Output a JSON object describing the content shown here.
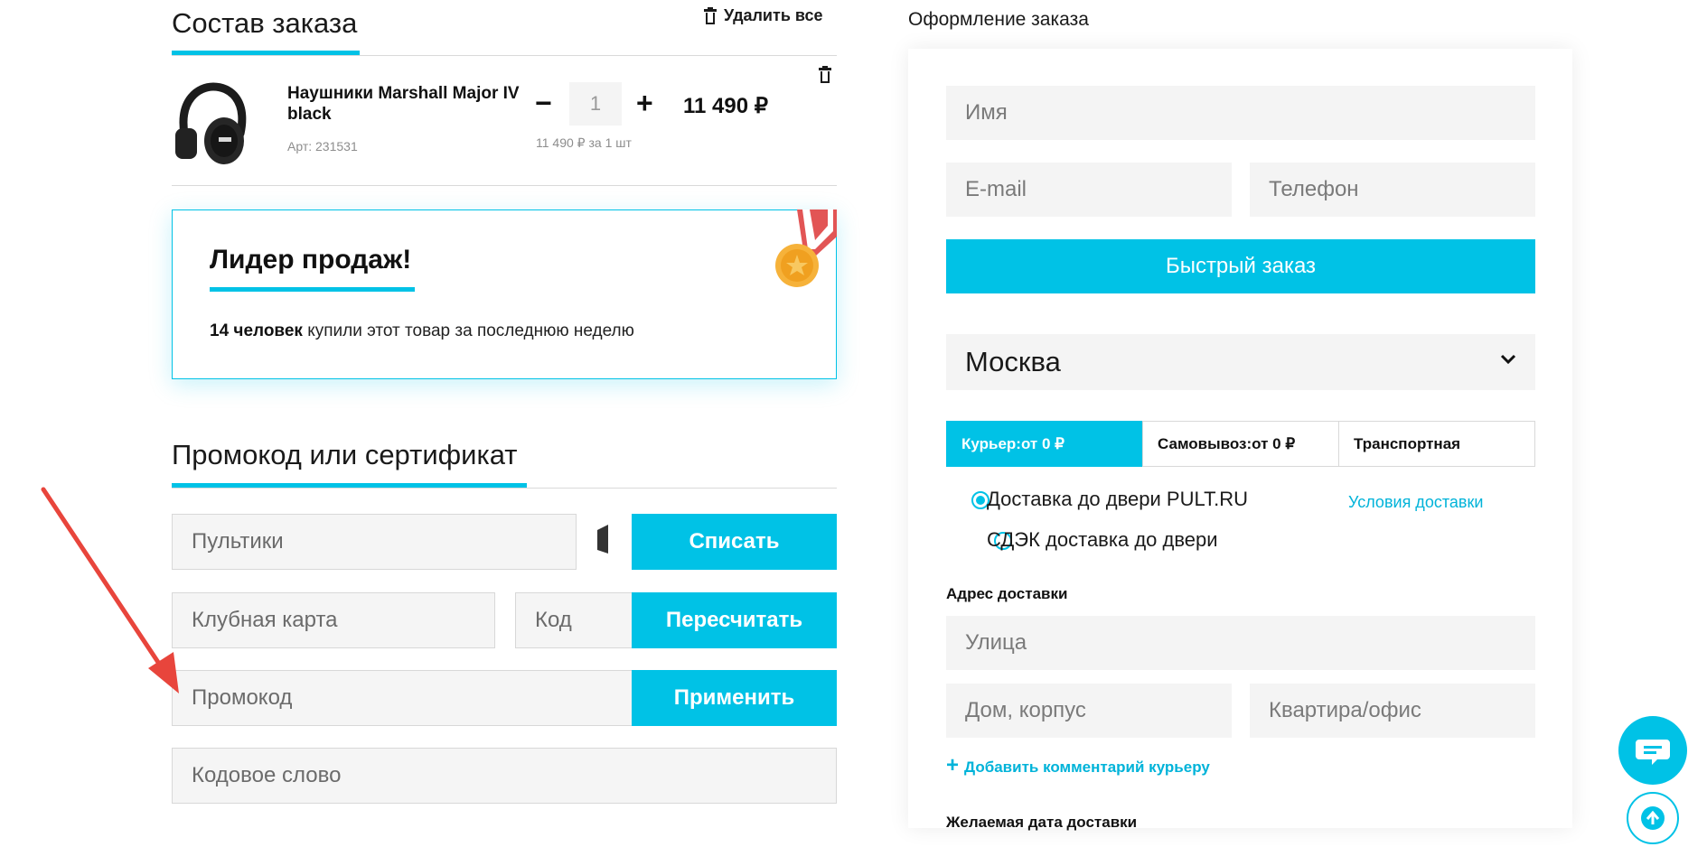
{
  "order": {
    "title": "Состав заказа",
    "delete_all_label": "Удалить все",
    "item": {
      "name_line1": "Наушники Marshall Major IV",
      "name_line2": "black",
      "article": "Арт: 231531",
      "quantity": "1",
      "price": "11 490 ₽",
      "unit_price": "11 490 ₽ за 1 шт"
    }
  },
  "leader": {
    "title": "Лидер продаж!",
    "count_text": "14 человек",
    "rest_text": " купили этот товар за последнюю неделю"
  },
  "promo": {
    "title": "Промокод или сертификат",
    "points_placeholder": "Пультики",
    "points_button": "Списать",
    "club_placeholder": "Клубная карта",
    "code_placeholder": "Код",
    "recalc_button": "Пересчитать",
    "promo_placeholder": "Промокод",
    "apply_button": "Применить",
    "codeword_placeholder": "Кодовое слово"
  },
  "checkout": {
    "title": "Оформление заказа",
    "name_placeholder": "Имя",
    "email_placeholder": "E-mail",
    "phone_placeholder": "Телефон",
    "quick_order_button": "Быстрый заказ",
    "city": "Москва",
    "tabs": [
      {
        "label": "Курьер:от 0 ₽",
        "active": true
      },
      {
        "label": "Самовывоз:от 0 ₽",
        "active": false
      },
      {
        "label": "Транспортная",
        "active": false
      }
    ],
    "delivery_options": [
      {
        "label": "Доставка до двери PULT.RU",
        "selected": true
      },
      {
        "label": "СДЭК доставка до двери",
        "selected": false
      }
    ],
    "delivery_terms_link": "Условия доставки",
    "address_label": "Адрес доставки",
    "street_placeholder": "Улица",
    "house_placeholder": "Дом, корпус",
    "apartment_placeholder": "Квартира/офис",
    "add_comment_link": "Добавить комментарий курьеру",
    "date_label": "Желаемая дата доставки"
  },
  "colors": {
    "accent": "#00c2e6",
    "annotation_arrow": "#e8453c"
  },
  "icons": {
    "chat": "chat-bubble-icon",
    "scroll_top": "arrow-up-icon",
    "trash": "trash-icon",
    "medal": "medal-icon",
    "chevron": "chevron-down-icon"
  }
}
